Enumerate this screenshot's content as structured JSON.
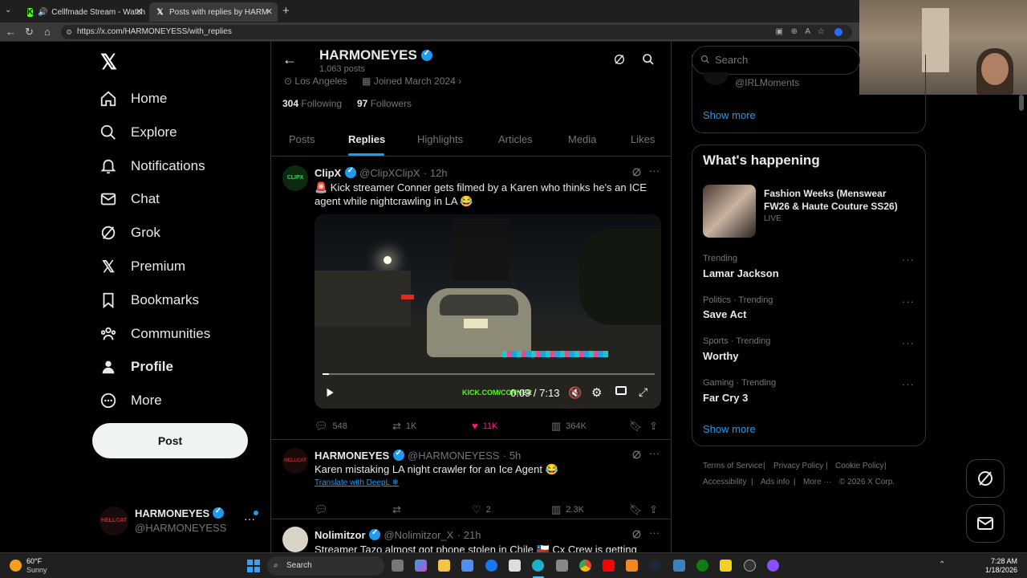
{
  "browser": {
    "tabs": [
      {
        "title": "Cellfmade Stream - Watch Liv"
      },
      {
        "title": "Posts with replies by HARMONEYE"
      }
    ],
    "url": "https://x.com/HARMONEYESS/with_replies"
  },
  "nav": {
    "items": [
      {
        "label": "Home"
      },
      {
        "label": "Explore"
      },
      {
        "label": "Notifications"
      },
      {
        "label": "Chat"
      },
      {
        "label": "Grok"
      },
      {
        "label": "Premium"
      },
      {
        "label": "Bookmarks"
      },
      {
        "label": "Communities"
      },
      {
        "label": "Profile"
      },
      {
        "label": "More"
      }
    ],
    "post_label": "Post",
    "account": {
      "name": "HARMONEYES",
      "handle": "@HARMONEYESS",
      "avatar_text": "HELLCAT"
    }
  },
  "profile": {
    "name": "HARMONEYES",
    "posts_count": "1,063 posts",
    "location": "Los Angeles",
    "joined": "Joined March 2024",
    "following_count": "304",
    "following_label": "Following",
    "followers_count": "97",
    "followers_label": "Followers",
    "tabs": [
      "Posts",
      "Replies",
      "Highlights",
      "Articles",
      "Media",
      "Likes"
    ],
    "active_tab": "Replies"
  },
  "tweets": [
    {
      "name": "ClipX",
      "handle": "@ClipXClipX",
      "time": "· 12h",
      "avatar_text": "CLIPX",
      "text_line1": "🚨 Kick streamer Conner gets filmed by a Karen who thinks he's an ICE",
      "text_line2": "agent while nightcrawling in LA 😂",
      "video": {
        "time": "0:09 / 7:13",
        "watermark": "KICK.COM/CONNER",
        "progress_fraction": 0.02
      },
      "replies": "548",
      "reposts": "1K",
      "likes": "11K",
      "views": "364K"
    },
    {
      "name": "HARMONEYES",
      "handle": "@HARMONEYESS",
      "time": "· 5h",
      "avatar_text": "HELLCAT",
      "text": "Karen mistaking LA night crawler for an Ice Agent 😂",
      "translate": "Translate with DeepL",
      "replies": "",
      "reposts": "",
      "likes": "2",
      "views": "2.3K"
    },
    {
      "name": "Nolimitzor",
      "handle": "@Nolimitzor_X",
      "time": "· 21h",
      "text": "Streamer Tazo almost got phone stolen in Chile 🇨🇱 Cx Crew is getting"
    }
  ],
  "right": {
    "search_placeholder": "Search",
    "top_account": "@IRLMoments",
    "show_more_1": "Show more",
    "happening_title": "What's happening",
    "event": {
      "title_line1": "Fashion Weeks (Menswear",
      "title_line2": "FW26 & Haute Couture SS26)",
      "status": "LIVE"
    },
    "trends": [
      {
        "meta": "Trending",
        "name": "Lamar Jackson"
      },
      {
        "meta": "Politics · Trending",
        "name": "Save Act"
      },
      {
        "meta": "Sports · Trending",
        "name": "Worthy"
      },
      {
        "meta": "Gaming · Trending",
        "name": "Far Cry 3"
      }
    ],
    "show_more_2": "Show more",
    "footer": [
      "Terms of Service",
      "Privacy Policy",
      "Cookie Policy",
      "Accessibility",
      "Ads info",
      "More ···",
      "© 2026 X Corp."
    ]
  },
  "taskbar": {
    "weather_temp": "60°F",
    "weather_desc": "Sunny",
    "search_label": "Search",
    "time": "7:28 AM",
    "date": "1/18/2026"
  },
  "colors": {
    "accent": "#1d9bf0",
    "like": "#f91880",
    "bg": "#000000",
    "border": "#2f3336"
  }
}
